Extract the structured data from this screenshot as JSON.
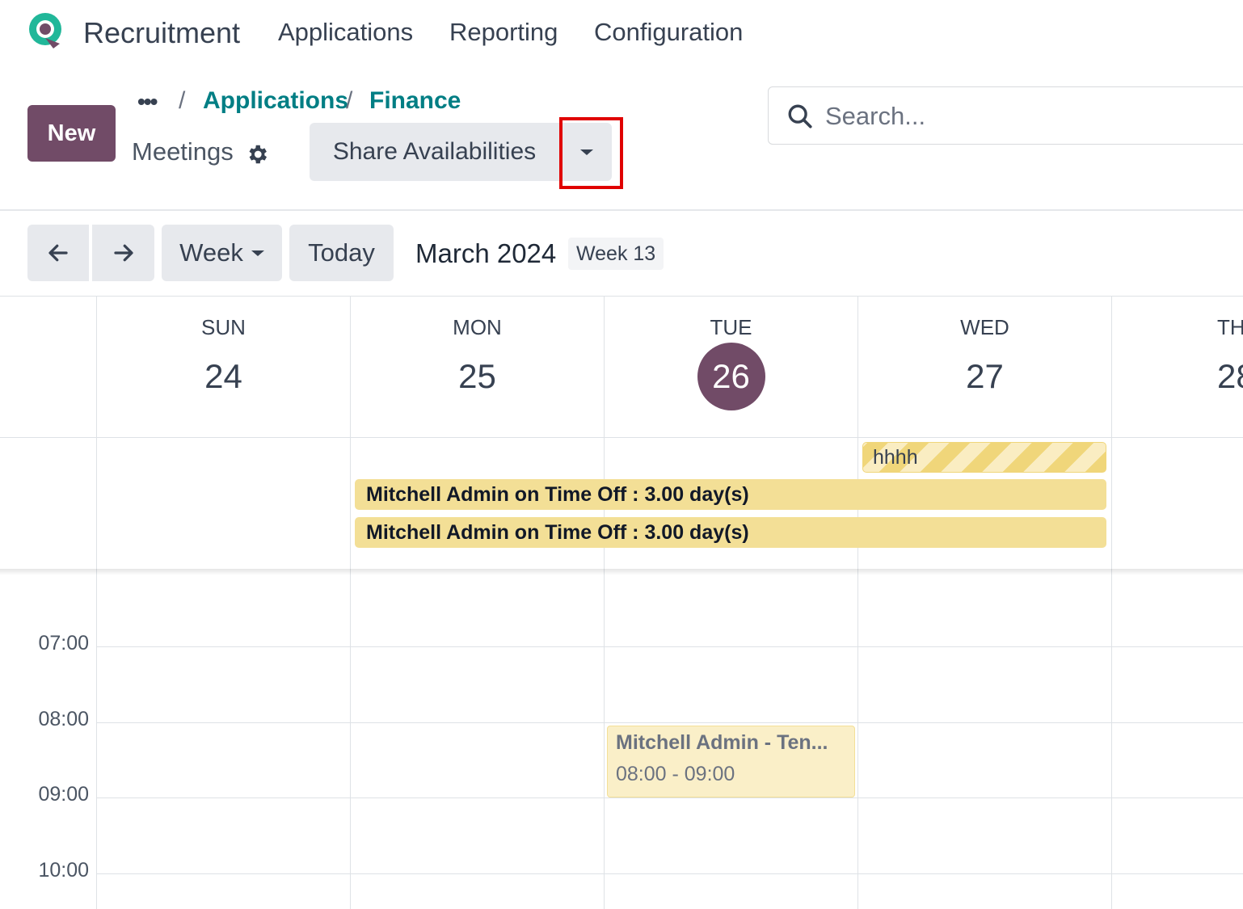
{
  "nav": {
    "app_title": "Recruitment",
    "items": [
      "Applications",
      "Reporting",
      "Configuration"
    ]
  },
  "control_panel": {
    "new_label": "New",
    "breadcrumb_more": "•••",
    "breadcrumb": [
      "Applications",
      "Finance"
    ],
    "breadcrumb_sep": "/",
    "view_name": "Meetings",
    "share_label": "Share Availabilities",
    "search_placeholder": "Search..."
  },
  "calendar": {
    "scale": "Week",
    "today_label": "Today",
    "title": "March 2024",
    "week_badge": "Week 13",
    "days": [
      {
        "name": "SUN",
        "num": "24"
      },
      {
        "name": "MON",
        "num": "25"
      },
      {
        "name": "TUE",
        "num": "26",
        "is_today": true
      },
      {
        "name": "WED",
        "num": "27"
      },
      {
        "name": "TH",
        "num": "28"
      }
    ],
    "all_day_events": [
      {
        "title": "hhhh"
      },
      {
        "title": "Mitchell Admin on Time Off : 3.00 day(s)"
      },
      {
        "title": "Mitchell Admin on Time Off : 3.00 day(s)"
      }
    ],
    "times": [
      "07:00",
      "08:00",
      "09:00",
      "10:00"
    ],
    "events": [
      {
        "title": "Mitchell Admin - Ten...",
        "time": "08:00 - 09:00"
      }
    ]
  },
  "colors": {
    "brand": "#714B67",
    "link": "#017e84",
    "time_off": "#f3df96",
    "highlight": "#e00000"
  }
}
